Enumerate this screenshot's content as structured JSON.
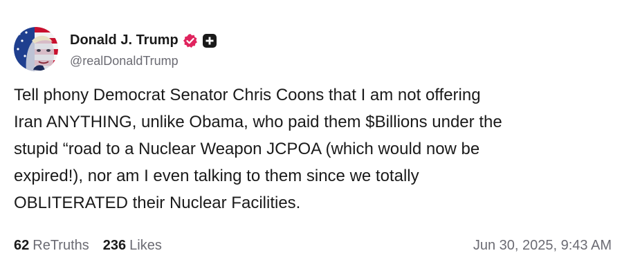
{
  "author": {
    "display_name": "Donald J. Trump",
    "handle": "@realDonaldTrump",
    "verified_badge_icon": "verified-badge-icon",
    "verified_badge_color": "#e0245e",
    "plus_badge_icon": "plus-square-icon"
  },
  "post": {
    "text": "Tell phony Democrat Senator Chris Coons that I am not offering\nIran ANYTHING, unlike Obama, who paid them $Billions under the\nstupid “road to a Nuclear Weapon JCPOA (which would now be\nexpired!), nor am I even talking to them since we totally\nOBLITERATED their Nuclear Facilities."
  },
  "footer": {
    "retruths_count": "62",
    "retruths_label": "ReTruths",
    "likes_count": "236",
    "likes_label": "Likes",
    "timestamp": "Jun 30, 2025, 9:43 AM"
  }
}
